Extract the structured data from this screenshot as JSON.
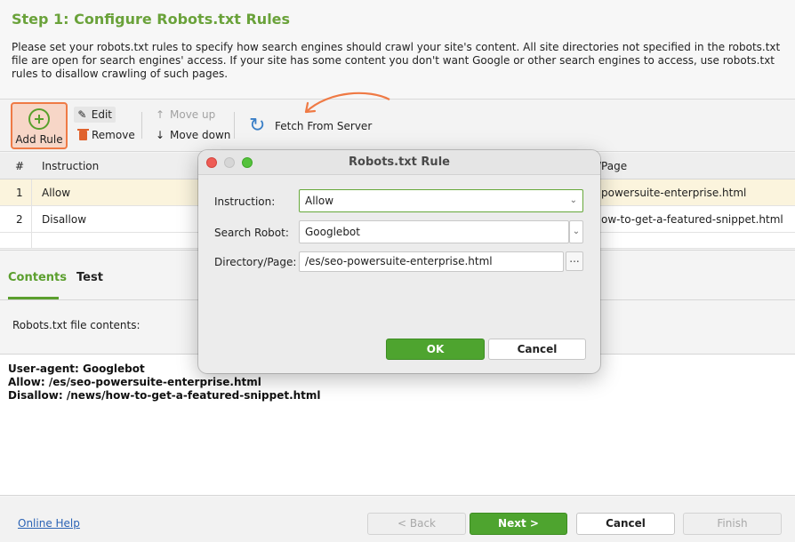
{
  "header": {
    "title": "Step 1: Configure Robots.txt Rules",
    "intro": "Please set your robots.txt rules to specify how search engines should crawl your site's content. All site directories not specified in the robots.txt file are open for search engines' access. If your site has some content you don't want Google or other search engines to access, use robots.txt rules to disallow crawling of such pages."
  },
  "toolbar": {
    "add_rule": "Add Rule",
    "edit": "Edit",
    "remove": "Remove",
    "move_up": "Move up",
    "move_down": "Move down",
    "fetch": "Fetch From Server"
  },
  "table": {
    "headers": {
      "num": "#",
      "instruction": "Instruction",
      "page": "/Page"
    },
    "rows": [
      {
        "num": "1",
        "instruction": "Allow",
        "page": "powersuite-enterprise.html"
      },
      {
        "num": "2",
        "instruction": "Disallow",
        "page": "ow-to-get-a-featured-snippet.html"
      }
    ]
  },
  "tabs": {
    "contents": "Contents",
    "test": "Test",
    "contents_label": "Robots.txt file contents:"
  },
  "file": {
    "lines": [
      "User-agent: Googlebot",
      "Allow: /es/seo-powersuite-enterprise.html",
      "Disallow: /news/how-to-get-a-featured-snippet.html"
    ]
  },
  "footer": {
    "help": "Online Help",
    "back": "< Back",
    "next": "Next >",
    "cancel": "Cancel",
    "finish": "Finish"
  },
  "dialog": {
    "title": "Robots.txt Rule",
    "instruction_label": "Instruction:",
    "instruction_value": "Allow",
    "robot_label": "Search Robot:",
    "robot_value": "Googlebot",
    "dir_label": "Directory/Page:",
    "dir_value": "/es/seo-powersuite-enterprise.html",
    "browse": "...",
    "ok": "OK",
    "cancel": "Cancel"
  },
  "colors": {
    "accent_green": "#5b9f2e",
    "highlight_orange": "#ef7a45",
    "link_blue": "#2b63b5"
  },
  "icons": {
    "add": "plus-circle-icon",
    "edit": "pencil-icon",
    "remove": "trash-icon",
    "move_up": "arrow-up-icon",
    "move_down": "arrow-down-icon",
    "fetch": "refresh-icon"
  }
}
